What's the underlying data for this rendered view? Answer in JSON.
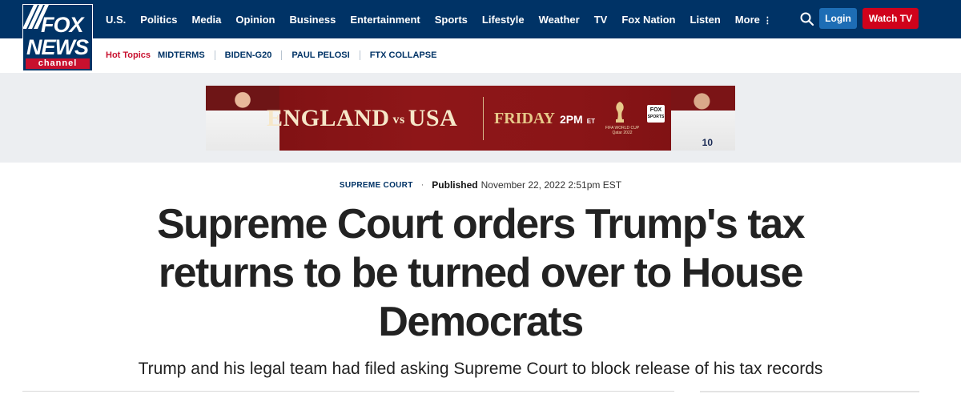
{
  "logo": {
    "line1": "FOX",
    "line2": "NEWS",
    "line3": "channel"
  },
  "nav": {
    "items": [
      {
        "label": "U.S."
      },
      {
        "label": "Politics"
      },
      {
        "label": "Media"
      },
      {
        "label": "Opinion"
      },
      {
        "label": "Business"
      },
      {
        "label": "Entertainment"
      },
      {
        "label": "Sports"
      },
      {
        "label": "Lifestyle"
      },
      {
        "label": "Weather"
      },
      {
        "label": "TV"
      },
      {
        "label": "Fox Nation"
      },
      {
        "label": "Listen"
      },
      {
        "label": "More"
      }
    ],
    "search_icon": "search-icon",
    "login_label": "Login",
    "watch_label": "Watch TV"
  },
  "hot_topics": {
    "label": "Hot Topics",
    "items": [
      {
        "label": "MIDTERMS"
      },
      {
        "label": "BIDEN-G20"
      },
      {
        "label": "PAUL PELOSI"
      },
      {
        "label": "FTX COLLAPSE"
      }
    ]
  },
  "ad": {
    "team1": "ENGLAND",
    "vs": "vs",
    "team2": "USA",
    "day": "FRIDAY",
    "time": "2PM",
    "tz": "ET",
    "event": "FIFA WORLD CUP Qatar 2022",
    "network_line1": "FOX",
    "network_line2": "SPORTS",
    "jersey_number": "10"
  },
  "article": {
    "kicker": "SUPREME COURT",
    "published_label": "Published",
    "published_date": "November 22, 2022 2:51pm EST",
    "headline": "Supreme Court orders Trump's tax returns to be turned over to House Democrats",
    "subheadline": "Trump and his legal team had filed asking Supreme Court to block release of his tax records"
  },
  "colors": {
    "nav_bg": "#003366",
    "login_bg": "#1d6db5",
    "watch_bg": "#d0021b",
    "hot_topics_label": "#c8102e",
    "ad_bg": "#8e1618"
  }
}
